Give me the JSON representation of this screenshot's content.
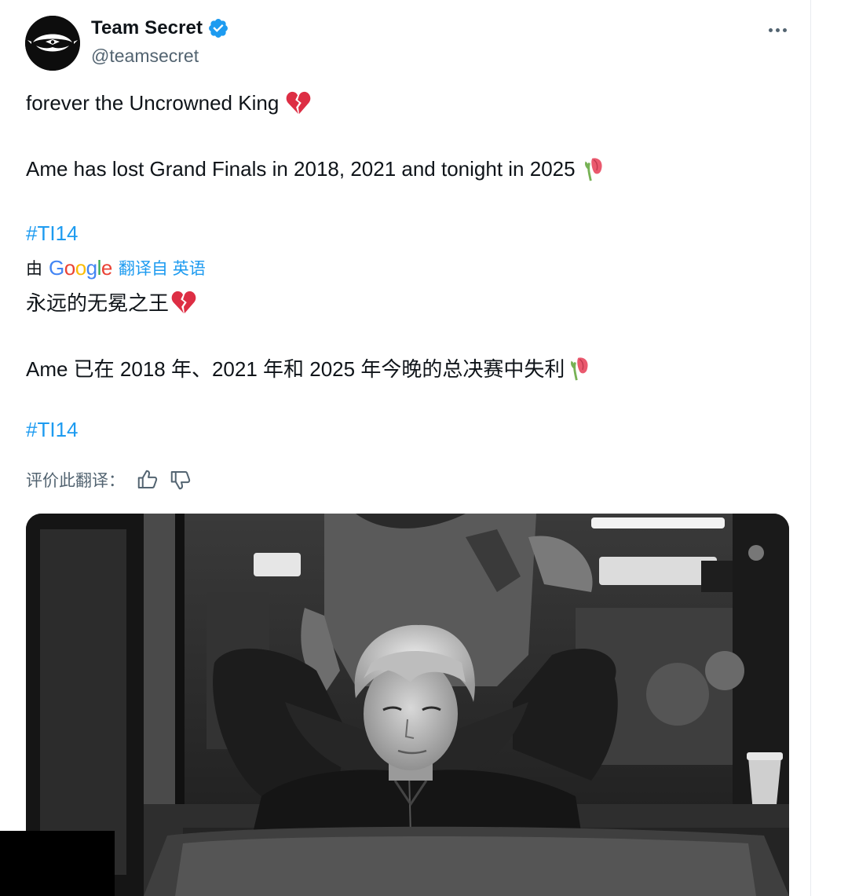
{
  "author": {
    "display_name": "Team Secret",
    "handle": "@teamsecret",
    "avatar_icon": "team-secret-logo-icon",
    "verified_icon": "verified-badge-icon",
    "verified_color": "#1d9bf0"
  },
  "more_icon": "more-options-icon",
  "tweet": {
    "line1": "forever the Uncrowned King",
    "line1_emoji": "broken-heart-emoji",
    "line2": "Ame has lost Grand Finals in 2018, 2021 and tonight in 2025",
    "line2_emoji": "wilted-flower-emoji",
    "hashtag": "#TI14"
  },
  "translation": {
    "by_label": "由",
    "provider": "Google",
    "link_label": "翻译自 英语",
    "line1": "永远的无冕之王",
    "line1_emoji": "broken-heart-emoji",
    "line2": "Ame 已在 2018 年、2021 年和 2025 年今晚的总决赛中失利",
    "line2_emoji": "wilted-flower-emoji",
    "hashtag": "#TI14"
  },
  "rating": {
    "label": "评价此翻译：",
    "thumbs_up_icon": "thumbs-up-icon",
    "thumbs_down_icon": "thumbs-down-icon"
  },
  "media": {
    "photo_icon": "black-and-white-player-photo"
  },
  "colors": {
    "link": "#1d9bf0",
    "text": "#0f1419",
    "secondary": "#536471",
    "google_blue": "#4285f4",
    "google_red": "#ea4335",
    "google_yellow": "#fbbc05",
    "google_green": "#34a853"
  }
}
